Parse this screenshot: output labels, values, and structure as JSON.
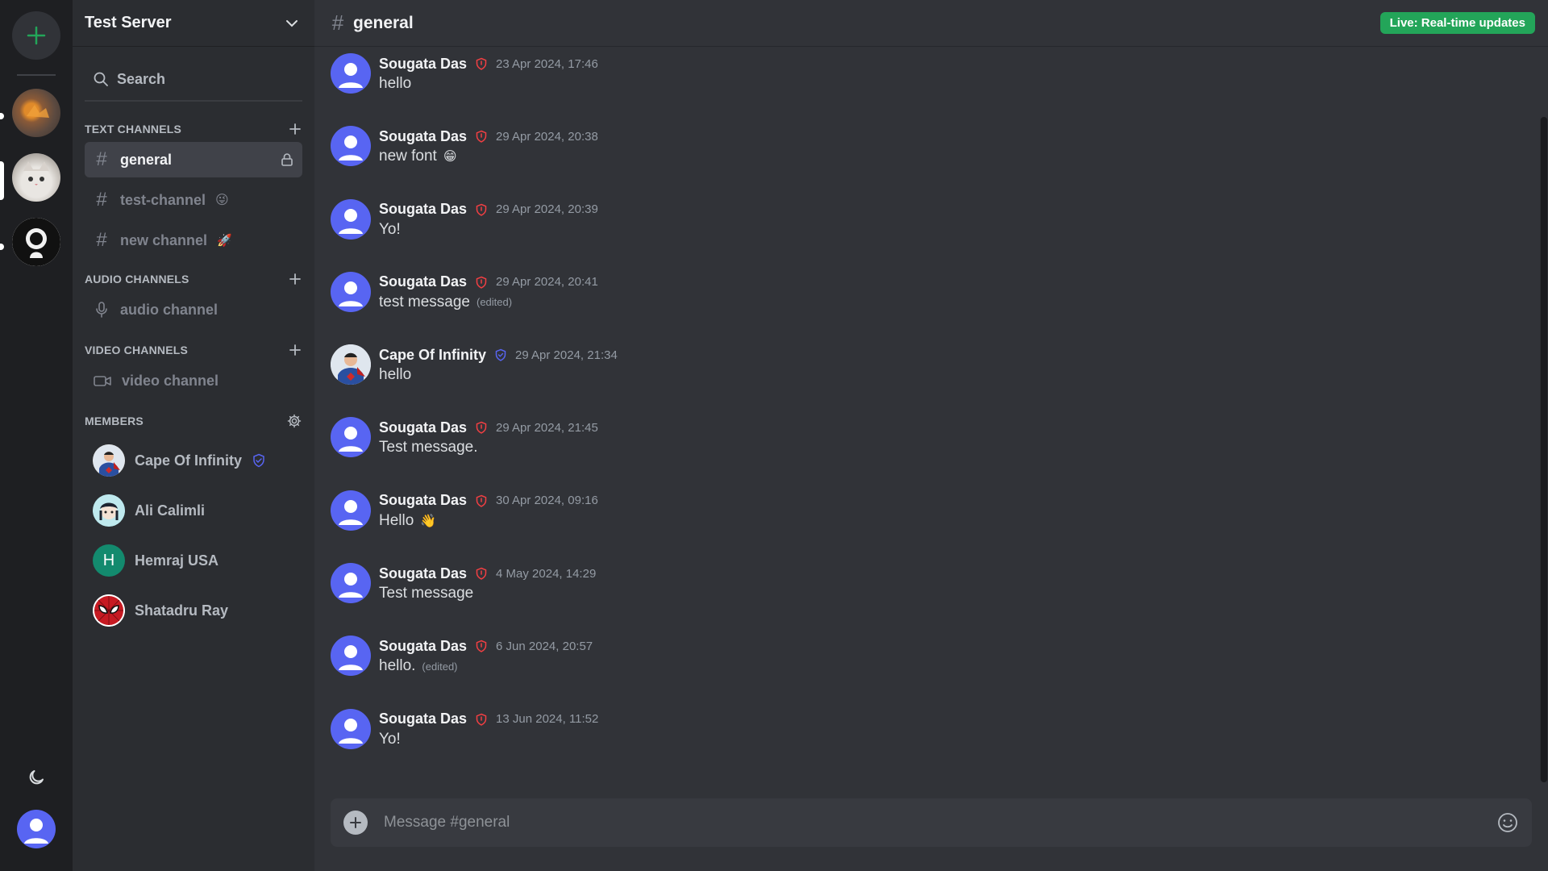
{
  "colors": {
    "accent": "#5865f2",
    "live": "#23a559",
    "mod_shield": "#f23f43",
    "verified_shield": "#5865f2"
  },
  "server": {
    "name": "Test Server"
  },
  "search": {
    "label": "Search"
  },
  "sections": {
    "text": "TEXT CHANNELS",
    "audio": "AUDIO CHANNELS",
    "video": "VIDEO CHANNELS",
    "members": "MEMBERS"
  },
  "text_channels": [
    {
      "name": "general",
      "emoji": "",
      "active": true,
      "locked": true
    },
    {
      "name": "test-channel",
      "emoji": "😜",
      "active": false
    },
    {
      "name": "new channel",
      "emoji": "🚀",
      "active": false
    }
  ],
  "audio_channels": [
    {
      "name": "audio channel"
    }
  ],
  "video_channels": [
    {
      "name": "video channel"
    }
  ],
  "members": [
    {
      "name": "Cape Of Infinity",
      "badge": "verified-shield-icon"
    },
    {
      "name": "Ali Calimli"
    },
    {
      "name": "Hemraj USA",
      "initial": "H"
    },
    {
      "name": "Shatadru Ray"
    }
  ],
  "channel_header": {
    "name": "general",
    "live_badge": "Live: Real-time updates"
  },
  "messages": [
    {
      "author": "Sougata Das",
      "time": "23 Apr 2024, 17:46",
      "text": "hello",
      "emoji": "",
      "edited": ""
    },
    {
      "author": "Sougata Das",
      "time": "29 Apr 2024, 20:38",
      "text": "new font",
      "emoji": "😁",
      "edited": ""
    },
    {
      "author": "Sougata Das",
      "time": "29 Apr 2024, 20:39",
      "text": "Yo!",
      "emoji": "",
      "edited": ""
    },
    {
      "author": "Sougata Das",
      "time": "29 Apr 2024, 20:41",
      "text": "test message",
      "emoji": "",
      "edited": "(edited)"
    },
    {
      "author": "Cape Of Infinity",
      "time": "29 Apr 2024, 21:34",
      "text": "hello",
      "emoji": "",
      "edited": ""
    },
    {
      "author": "Sougata Das",
      "time": "29 Apr 2024, 21:45",
      "text": "Test message.",
      "emoji": "",
      "edited": ""
    },
    {
      "author": "Sougata Das",
      "time": "30 Apr 2024, 09:16",
      "text": "Hello",
      "emoji": "👋",
      "edited": ""
    },
    {
      "author": "Sougata Das",
      "time": "4 May 2024, 14:29",
      "text": "Test message",
      "emoji": "",
      "edited": ""
    },
    {
      "author": "Sougata Das",
      "time": "6 Jun 2024, 20:57",
      "text": "hello.",
      "emoji": "",
      "edited": "(edited)"
    },
    {
      "author": "Sougata Das",
      "time": "13 Jun 2024, 11:52",
      "text": "Yo!",
      "emoji": "",
      "edited": ""
    }
  ],
  "composer": {
    "placeholder": "Message #general"
  }
}
